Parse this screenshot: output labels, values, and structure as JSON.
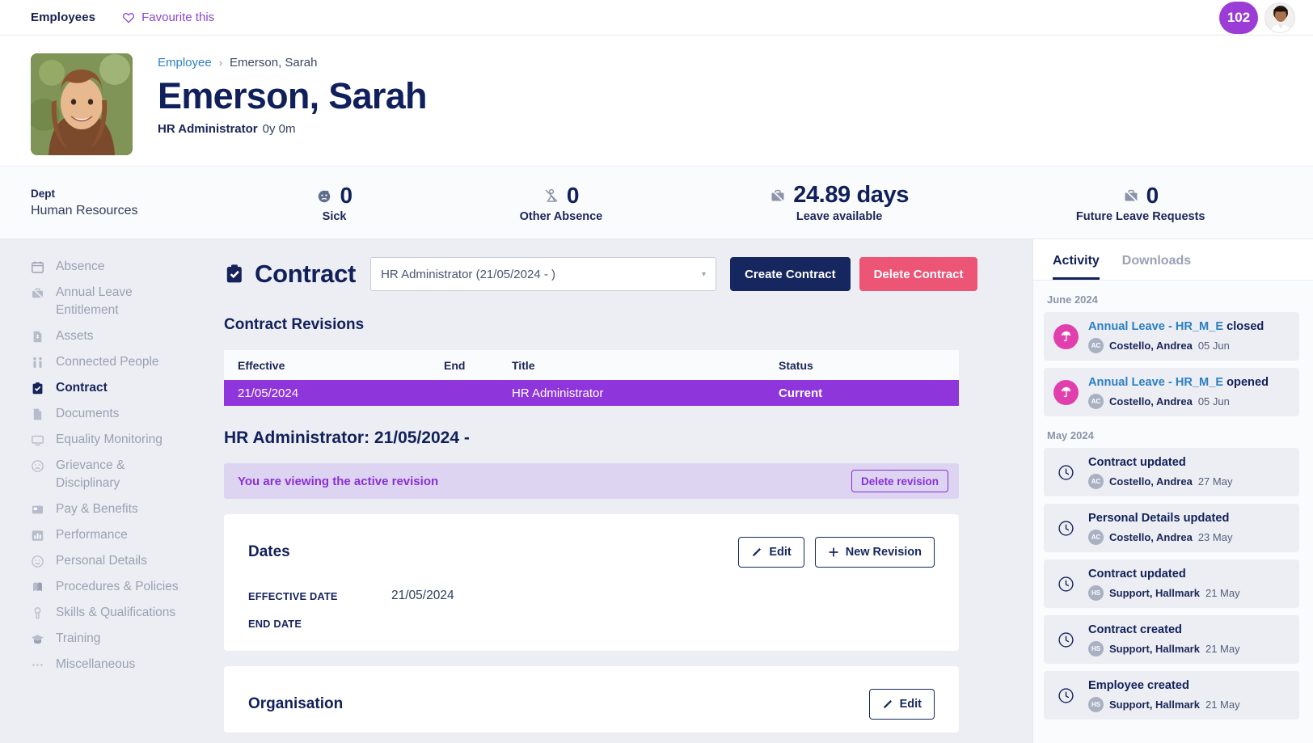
{
  "topbar": {
    "title": "Employees",
    "favourite_label": "Favourite this",
    "favourite_icon": "heart-outline-icon",
    "notification_count": "102",
    "avatar_icon": "user-avatar"
  },
  "employee": {
    "breadcrumb_root": "Employee",
    "breadcrumb_sep": "›",
    "breadcrumb_current": "Emerson, Sarah",
    "name": "Emerson, Sarah",
    "role": "HR Administrator",
    "tenure": "0y 0m",
    "photo_icon": "employee-photo"
  },
  "stats": {
    "dept_label": "Dept",
    "dept_value": "Human Resources",
    "items": [
      {
        "icon": "sick-face-icon",
        "value": "0",
        "label": "Sick"
      },
      {
        "icon": "absence-person-icon",
        "value": "0",
        "label": "Other Absence"
      },
      {
        "icon": "briefcase-icon",
        "value": "24.89 days",
        "label": "Leave available"
      },
      {
        "icon": "briefcase-slash-icon",
        "value": "0",
        "label": "Future Leave Requests"
      }
    ]
  },
  "sidebar": {
    "items": [
      {
        "label": "Absence",
        "icon": "calendar-icon",
        "active": false
      },
      {
        "label": "Annual Leave\nEntitlement",
        "icon": "briefcase-slash-icon",
        "active": false
      },
      {
        "label": "Assets",
        "icon": "document-icon",
        "active": false
      },
      {
        "label": "Connected People",
        "icon": "people-icon",
        "active": false
      },
      {
        "label": "Contract",
        "icon": "clipboard-check-icon",
        "active": true
      },
      {
        "label": "Documents",
        "icon": "file-icon",
        "active": false
      },
      {
        "label": "Equality Monitoring",
        "icon": "monitor-icon",
        "active": false
      },
      {
        "label": "Grievance &\nDisciplinary",
        "icon": "sad-face-icon",
        "active": false
      },
      {
        "label": "Pay & Benefits",
        "icon": "card-icon",
        "active": false
      },
      {
        "label": "Performance",
        "icon": "bar-chart-icon",
        "active": false
      },
      {
        "label": "Personal Details",
        "icon": "smiley-icon",
        "active": false
      },
      {
        "label": "Procedures & Policies",
        "icon": "book-icon",
        "active": false
      },
      {
        "label": "Skills & Qualifications",
        "icon": "medal-icon",
        "active": false
      },
      {
        "label": "Training",
        "icon": "graduation-cap-icon",
        "active": false
      },
      {
        "label": "Miscellaneous",
        "icon": "ellipsis-icon",
        "active": false
      }
    ]
  },
  "contract": {
    "heading": "Contract",
    "heading_icon": "clipboard-check-icon",
    "selected_contract": "HR Administrator (21/05/2024 - )",
    "select_caret": "▾",
    "create_label": "Create Contract",
    "delete_label": "Delete Contract",
    "revisions_title": "Contract Revisions",
    "table": {
      "columns": [
        "Effective",
        "End",
        "Title",
        "Status"
      ],
      "rows": [
        {
          "effective": "21/05/2024",
          "end": "",
          "title": "HR Administrator",
          "status": "Current",
          "selected": true
        }
      ]
    },
    "revision_heading": "HR Administrator: 21/05/2024 -",
    "alert_text": "You are viewing the active revision",
    "delete_revision_label": "Delete revision",
    "dates_card": {
      "title": "Dates",
      "edit_label": "Edit",
      "edit_icon": "pencil-icon",
      "new_revision_label": "New Revision",
      "new_revision_icon": "plus-icon",
      "fields": [
        {
          "label": "EFFECTIVE DATE",
          "value": "21/05/2024"
        },
        {
          "label": "END DATE",
          "value": ""
        }
      ]
    },
    "organisation_card": {
      "title": "Organisation",
      "edit_label": "Edit",
      "edit_icon": "pencil-icon"
    }
  },
  "activity": {
    "tabs": [
      {
        "label": "Activity",
        "active": true
      },
      {
        "label": "Downloads",
        "active": false
      }
    ],
    "groups": [
      {
        "month": "June 2024",
        "items": [
          {
            "link_text": "Annual Leave - HR_M_E",
            "suffix": " closed",
            "icon": "umbrella-icon",
            "icon_style": "pink",
            "initials": "AC",
            "who": "Costello, Andrea",
            "when": "05 Jun"
          },
          {
            "link_text": "Annual Leave - HR_M_E",
            "suffix": " opened",
            "icon": "umbrella-icon",
            "icon_style": "pink",
            "initials": "AC",
            "who": "Costello, Andrea",
            "when": "05 Jun"
          }
        ]
      },
      {
        "month": "May 2024",
        "items": [
          {
            "link_text": "",
            "suffix": "Contract updated",
            "icon": "clock-icon",
            "icon_style": "plain",
            "initials": "AC",
            "who": "Costello, Andrea",
            "when": "27 May"
          },
          {
            "link_text": "",
            "suffix": "Personal Details updated",
            "icon": "clock-icon",
            "icon_style": "plain",
            "initials": "AC",
            "who": "Costello, Andrea",
            "when": "23 May"
          },
          {
            "link_text": "",
            "suffix": "Contract updated",
            "icon": "clock-icon",
            "icon_style": "plain",
            "initials": "HS",
            "who": "Support, Hallmark",
            "when": "21 May"
          },
          {
            "link_text": "",
            "suffix": "Contract created",
            "icon": "clock-icon",
            "icon_style": "plain",
            "initials": "HS",
            "who": "Support, Hallmark",
            "when": "21 May"
          },
          {
            "link_text": "",
            "suffix": "Employee created",
            "icon": "clock-icon",
            "icon_style": "plain",
            "initials": "HS",
            "who": "Support, Hallmark",
            "when": "21 May"
          }
        ]
      }
    ]
  },
  "colors": {
    "navy": "#15275e",
    "purple": "#8e35dc",
    "pink": "#ed5576",
    "link_blue": "#2b7fc4",
    "bg": "#eceef3"
  }
}
